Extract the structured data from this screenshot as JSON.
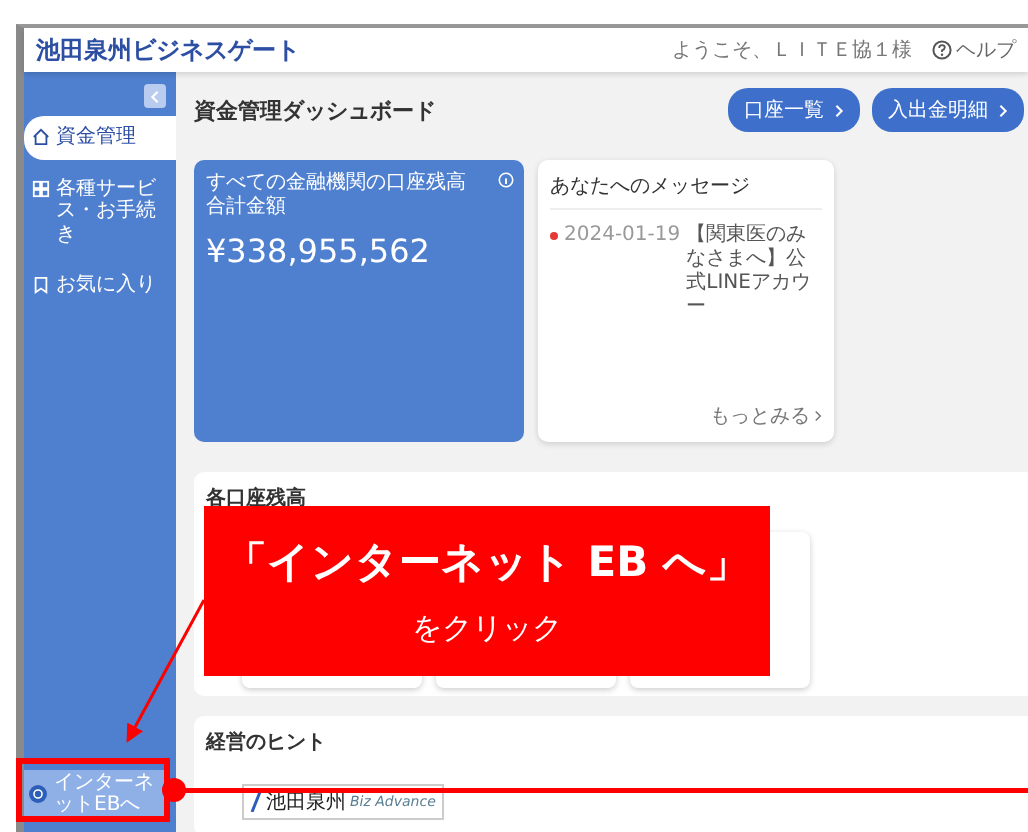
{
  "header": {
    "logo": "池田泉州ビジネスゲート",
    "welcome": "ようこそ、ＬＩＴＥ協１様",
    "help": "ヘルプ"
  },
  "sidebar": {
    "items": [
      {
        "label": "資金管理",
        "selected": true
      },
      {
        "label": "各種サービス・お手続き",
        "selected": false
      },
      {
        "label": "お気に入り",
        "selected": false
      }
    ],
    "bottom_link": {
      "label": "インターネットEBへ"
    }
  },
  "page_title": "資金管理ダッシュボード",
  "header_buttons": [
    {
      "label": "口座一覧"
    },
    {
      "label": "入出金明細"
    }
  ],
  "balance_card": {
    "title": "すべての金融機関の口座残高合計金額",
    "amount": "¥338,955,562"
  },
  "messages": {
    "title": "あなたへのメッセージ",
    "items": [
      {
        "date": "2024-01-19",
        "text": "【関東医のみなさまへ】公式LINEアカウー",
        "unread": true
      }
    ],
    "more": "もっとみる"
  },
  "accounts": {
    "title": "各口座残高"
  },
  "tips": {
    "title": "経営のヒント",
    "banner": {
      "brand": "池田泉州",
      "sub": "Biz Advance"
    }
  },
  "annotation": {
    "heading": "「インターネット EB へ」",
    "action": "をクリック"
  }
}
